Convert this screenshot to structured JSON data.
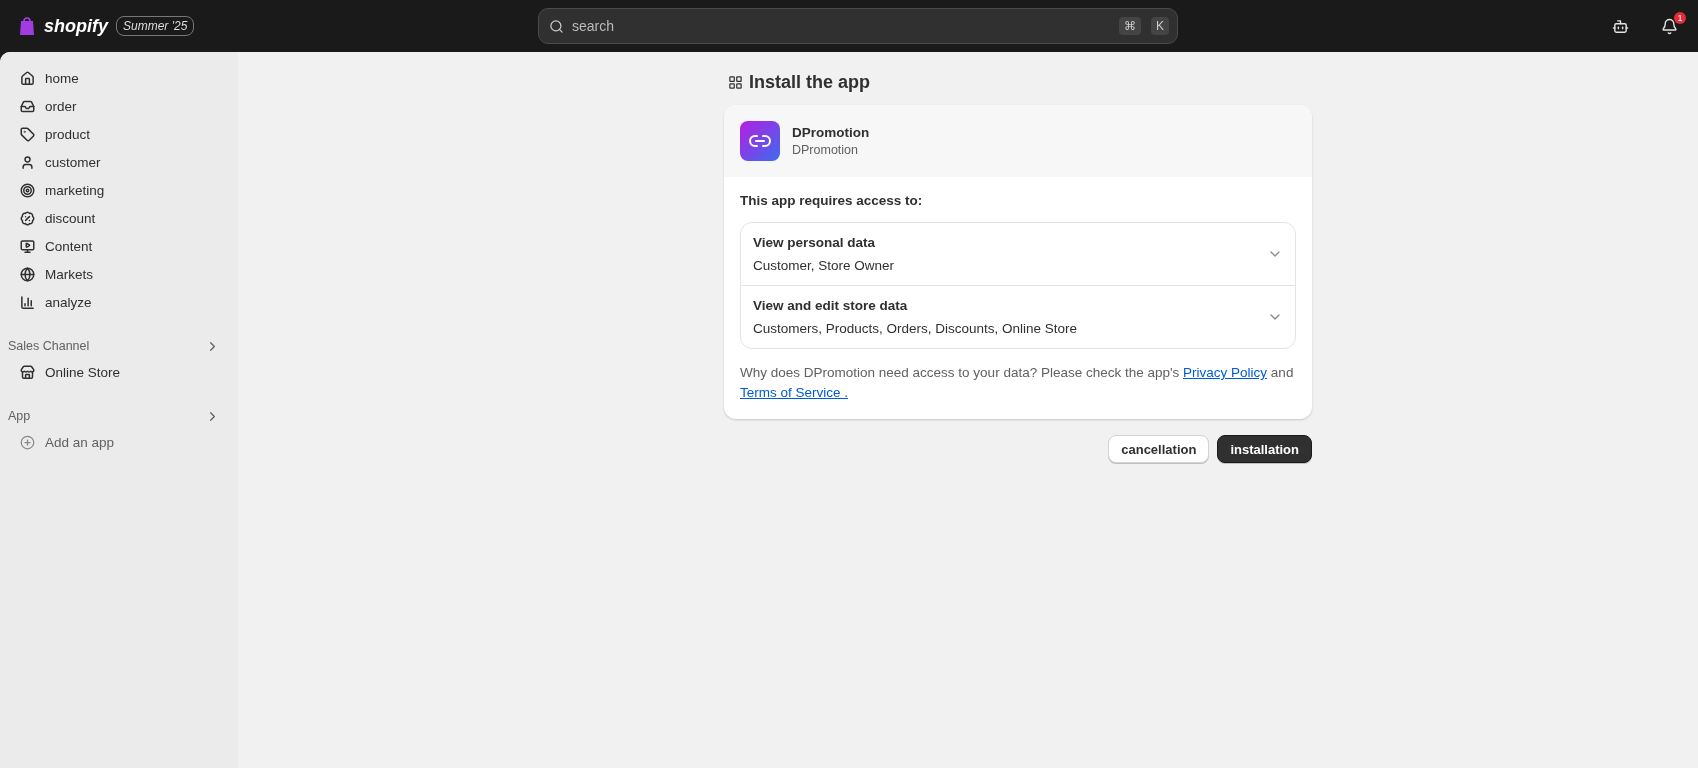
{
  "topbar": {
    "logo": "shopify",
    "edition": "Summer '25",
    "search": {
      "placeholder": "search",
      "shortcut_keys": [
        "⌘",
        "K"
      ]
    },
    "notifications": {
      "count": "1"
    }
  },
  "sidebar": {
    "items": [
      {
        "label": "home",
        "selected": false
      },
      {
        "label": "order",
        "selected": false
      },
      {
        "label": "product",
        "selected": false
      },
      {
        "label": "customer",
        "selected": false
      },
      {
        "label": "marketing",
        "selected": false
      },
      {
        "label": "discount",
        "selected": false
      },
      {
        "label": "Content",
        "selected": false
      },
      {
        "label": "Markets",
        "selected": false
      },
      {
        "label": "analyze",
        "selected": false
      }
    ],
    "sections": [
      {
        "title": "Sales Channel",
        "items": [
          {
            "label": "Online Store",
            "kind": "store"
          }
        ]
      },
      {
        "title": "App",
        "items": [
          {
            "label": "Add an app",
            "kind": "add"
          }
        ]
      }
    ]
  },
  "page": {
    "title": "Install the app",
    "app": {
      "name": "DPromotion",
      "developer": "DPromotion"
    },
    "access_heading": "This app requires access to:",
    "permissions": [
      {
        "title": "View personal data",
        "detail": "Customer, Store Owner",
        "expanded": false
      },
      {
        "title": "View and edit store data",
        "detail": "Customers, Products, Orders, Discounts, Online Store",
        "expanded": false
      }
    ],
    "notice": [
      {
        "kind": "text",
        "text": "Why does DPromotion need access to your data? Please check the app's "
      },
      {
        "kind": "link",
        "text": "Privacy Policy"
      },
      {
        "kind": "text",
        "text": " and "
      },
      {
        "kind": "link",
        "text": "Terms of Service ."
      }
    ],
    "buttons": [
      {
        "label": "cancellation",
        "kind": "secondary"
      },
      {
        "label": "installation",
        "kind": "primary"
      }
    ]
  }
}
